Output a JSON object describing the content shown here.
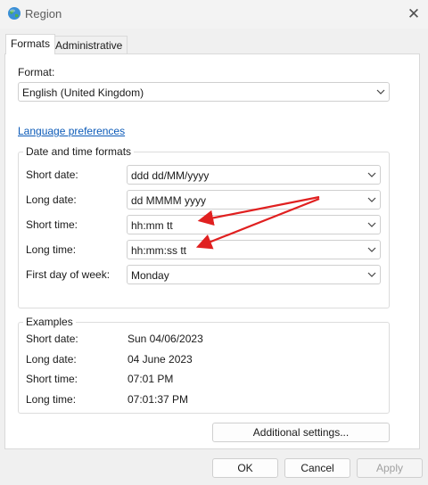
{
  "window": {
    "title": "Region",
    "close_glyph": "✕"
  },
  "tabs": [
    {
      "label": "Formats",
      "active": true
    },
    {
      "label": "Administrative",
      "active": false
    }
  ],
  "format": {
    "label": "Format:",
    "value": "English (United Kingdom)"
  },
  "language_link": "Language preferences",
  "date_time_formats": {
    "title": "Date and time formats",
    "short_date": {
      "label": "Short date:",
      "value": "ddd dd/MM/yyyy"
    },
    "long_date": {
      "label": "Long date:",
      "value": "dd MMMM yyyy"
    },
    "short_time": {
      "label": "Short time:",
      "value": "hh:mm tt"
    },
    "long_time": {
      "label": "Long time:",
      "value": "hh:mm:ss tt"
    },
    "first_day": {
      "label": "First day of week:",
      "value": "Monday"
    }
  },
  "examples": {
    "title": "Examples",
    "short_date": {
      "label": "Short date:",
      "value": "Sun 04/06/2023"
    },
    "long_date": {
      "label": "Long date:",
      "value": "04 June 2023"
    },
    "short_time": {
      "label": "Short time:",
      "value": "07:01 PM"
    },
    "long_time": {
      "label": "Long time:",
      "value": "07:01:37 PM"
    }
  },
  "buttons": {
    "additional": "Additional settings...",
    "ok": "OK",
    "cancel": "Cancel",
    "apply": "Apply"
  },
  "colors": {
    "link": "#0b5ab8",
    "annotation_arrow": "#e02020"
  },
  "icons": {
    "app": "globe-icon",
    "dropdown": "chevron-down-icon",
    "close": "close-icon"
  }
}
